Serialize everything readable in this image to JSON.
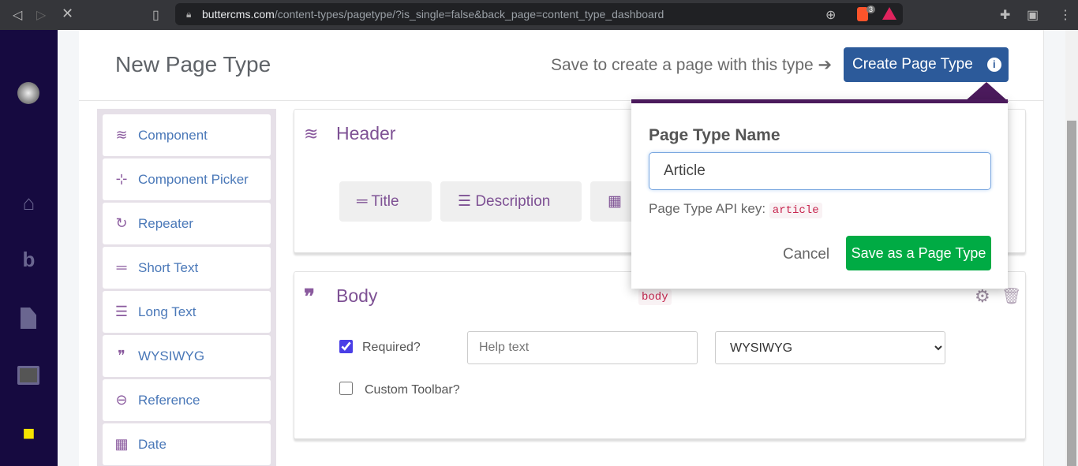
{
  "browser": {
    "url_host": "buttercms.com",
    "url_path": "/content-types/pagetype/?is_single=false&back_page=content_type_dashboard",
    "shield_count": "3"
  },
  "nav": {
    "items": [
      {
        "icon": "avatar"
      },
      {
        "icon": "home-icon"
      },
      {
        "icon": "blog-icon"
      },
      {
        "icon": "page-icon"
      },
      {
        "icon": "grid-icon"
      },
      {
        "icon": "content-types-icon"
      }
    ]
  },
  "header": {
    "title": "New Page Type",
    "hint": "Save to create a page with this type",
    "create_label": "Create Page Type"
  },
  "fields": [
    {
      "label": "Component",
      "icon": "layers-icon"
    },
    {
      "label": "Component Picker",
      "icon": "layers-plus-icon"
    },
    {
      "label": "Repeater",
      "icon": "redo-icon"
    },
    {
      "label": "Short Text",
      "icon": "short-text-icon"
    },
    {
      "label": "Long Text",
      "icon": "long-text-icon"
    },
    {
      "label": "WYSIWYG",
      "icon": "quote-icon"
    },
    {
      "label": "Reference",
      "icon": "link-icon"
    },
    {
      "label": "Date",
      "icon": "calendar-icon"
    }
  ],
  "header_card": {
    "title": "Header",
    "chips": [
      "Title",
      "Description"
    ]
  },
  "body_card": {
    "title": "Body",
    "api_key": "body",
    "required_label": "Required?",
    "required_checked": true,
    "help_placeholder": "Help text",
    "type_value": "WYSIWYG",
    "custom_toolbar_label": "Custom Toolbar?",
    "custom_toolbar_checked": false
  },
  "popover": {
    "label": "Page Type Name",
    "name_value": "Article",
    "api_key_label": "Page Type API key:",
    "api_key": "article",
    "cancel_label": "Cancel",
    "save_label": "Save as a Page Type"
  },
  "colors": {
    "primary": "#2c5a9a",
    "success": "#00ab44",
    "accent": "#7e5194",
    "nav_bg": "#160a40"
  }
}
